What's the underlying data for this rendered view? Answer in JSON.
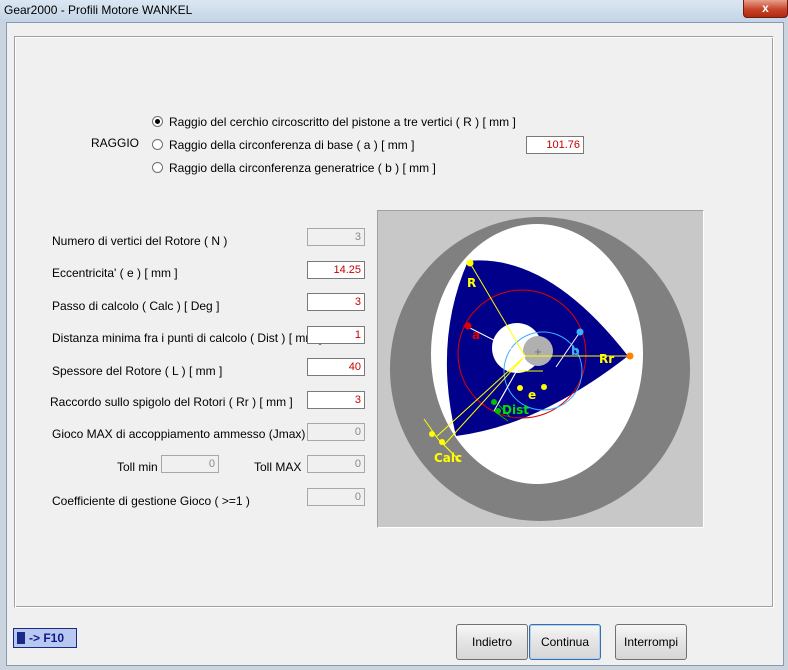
{
  "window": {
    "title": "Gear2000 - Profili Motore WANKEL",
    "close_symbol": "x"
  },
  "raggio": {
    "label": "RAGGIO",
    "options": [
      {
        "label": "Raggio del cerchio circoscritto del pistone a tre vertici ( R ) [ mm ]",
        "selected": true
      },
      {
        "label": "Raggio della circonferenza di base ( a ) [ mm ]",
        "selected": false
      },
      {
        "label": "Raggio della circonferenza generatrice ( b ) [ mm ]",
        "selected": false
      }
    ],
    "value": "101.76"
  },
  "params": [
    {
      "label": "Numero di vertici del Rotore ( N )",
      "value": "3",
      "enabled": false
    },
    {
      "label": "Eccentricita'  ( e ) [ mm ]",
      "value": "14.25",
      "enabled": true
    },
    {
      "label": "Passo di calcolo ( Calc ) [ Deg ]",
      "value": "3",
      "enabled": true
    },
    {
      "label": "Distanza minima fra i punti di calcolo ( Dist ) [ mm ]",
      "value": "1",
      "enabled": true
    },
    {
      "label": "Spessore del Rotore ( L ) [ mm ]",
      "value": "40",
      "enabled": true
    },
    {
      "label": "Raccordo sullo spigolo del Rotori ( Rr ) [ mm ]",
      "value": "3",
      "enabled": true
    },
    {
      "label": "Gioco MAX di accoppiamento ammesso (Jmax) [mm]",
      "value": "0",
      "enabled": false
    }
  ],
  "toll": {
    "min_label": "Toll min",
    "min_value": "0",
    "max_label": "Toll MAX",
    "max_value": "0"
  },
  "coeff": {
    "label": "Coefficiente di gestione Gioco ( >=1 )",
    "value": "0"
  },
  "diagram": {
    "labels": {
      "R": "R",
      "a": "a",
      "b": "b",
      "Rr": "Rr",
      "e": "e",
      "Dist": "Dist",
      "Calc": "Calc"
    }
  },
  "footer": {
    "f10_label": "-> F10",
    "back": "Indietro",
    "continue": "Continua",
    "stop": "Interrompi"
  }
}
